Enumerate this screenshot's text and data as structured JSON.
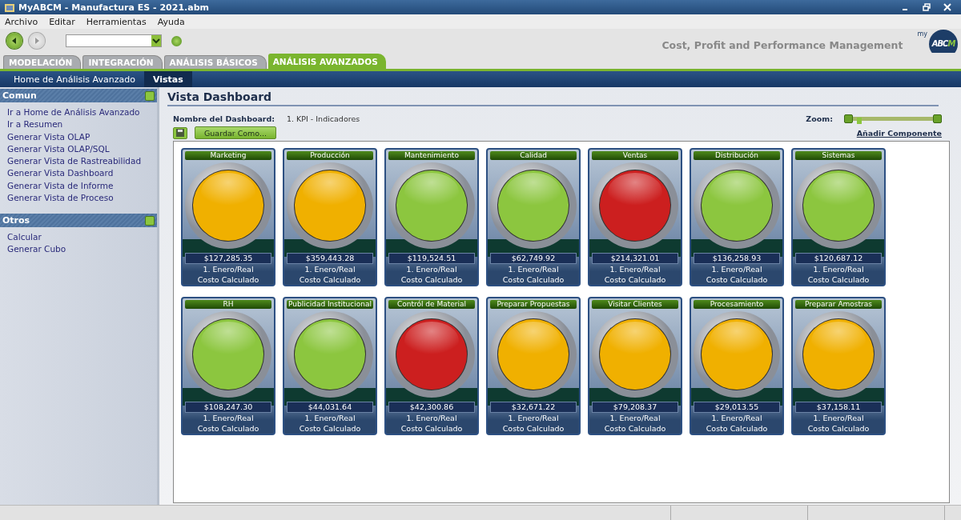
{
  "window": {
    "title": "MyABCM - Manufactura ES - 2021.abm"
  },
  "menu": [
    "Archivo",
    "Editar",
    "Herramientas",
    "Ayuda"
  ],
  "toolbar": {
    "tagline": "Cost, Profit and Performance Management",
    "logo": {
      "prefix": "my",
      "letters": "ABC",
      "accent": "M"
    }
  },
  "tabs": [
    {
      "label": "MODELACIÓN",
      "selected": false
    },
    {
      "label": "INTEGRACIÓN",
      "selected": false
    },
    {
      "label": "ANÁLISIS BÁSICOS",
      "selected": false
    },
    {
      "label": "ANÁLISIS AVANZADOS",
      "selected": true
    }
  ],
  "subnav": [
    {
      "label": "Home de Análisis Avanzado",
      "selected": false
    },
    {
      "label": "Vistas",
      "selected": true
    }
  ],
  "sidebar": {
    "sections": [
      {
        "title": "Comun",
        "items": [
          "Ir a Home de Análisis Avanzado",
          "Ir a Resumen",
          "Generar Vista OLAP",
          "Generar Vista OLAP/SQL",
          "Generar Vista de Rastreabilidad",
          "Generar Vista Dashboard",
          "Generar Vista de Informe",
          "Generar Vista de Proceso"
        ]
      },
      {
        "title": "Otros",
        "items": [
          "Calcular",
          "Generar Cubo"
        ]
      }
    ]
  },
  "content": {
    "title": "Vista Dashboard",
    "name_label": "Nombre del Dashboard:",
    "name_value": "1. KPI - Indicadores",
    "zoom": {
      "label": "Zoom:",
      "level": 0.05
    },
    "save_as": "Guardar Como...",
    "add_component": "Añadir Componente",
    "indicators": [
      {
        "title": "Marketing",
        "color": "#f0b000",
        "value": "$127,285.35",
        "period": "1. Enero/Real",
        "measure": "Costo Calculado"
      },
      {
        "title": "Producción",
        "color": "#f0b000",
        "value": "$359,443.28",
        "period": "1. Enero/Real",
        "measure": "Costo Calculado"
      },
      {
        "title": "Mantenimiento",
        "color": "#8cc63f",
        "value": "$119,524.51",
        "period": "1. Enero/Real",
        "measure": "Costo Calculado"
      },
      {
        "title": "Calidad",
        "color": "#8cc63f",
        "value": "$62,749.92",
        "period": "1. Enero/Real",
        "measure": "Costo Calculado"
      },
      {
        "title": "Ventas",
        "color": "#cc1f1f",
        "value": "$214,321.01",
        "period": "1. Enero/Real",
        "measure": "Costo Calculado"
      },
      {
        "title": "Distribución",
        "color": "#8cc63f",
        "value": "$136,258.93",
        "period": "1. Enero/Real",
        "measure": "Costo Calculado"
      },
      {
        "title": "Sistemas",
        "color": "#8cc63f",
        "value": "$120,687.12",
        "period": "1. Enero/Real",
        "measure": "Costo Calculado"
      },
      {
        "title": "RH",
        "color": "#8cc63f",
        "value": "$108,247.30",
        "period": "1. Enero/Real",
        "measure": "Costo Calculado"
      },
      {
        "title": "Publicidad Institucional",
        "color": "#8cc63f",
        "value": "$44,031.64",
        "period": "1. Enero/Real",
        "measure": "Costo Calculado"
      },
      {
        "title": "Contról de Material",
        "color": "#cc1f1f",
        "value": "$42,300.86",
        "period": "1. Enero/Real",
        "measure": "Costo Calculado"
      },
      {
        "title": "Preparar Propuestas",
        "color": "#f0b000",
        "value": "$32,671.22",
        "period": "1. Enero/Real",
        "measure": "Costo Calculado"
      },
      {
        "title": "Visitar Clientes",
        "color": "#f0b000",
        "value": "$79,208.37",
        "period": "1. Enero/Real",
        "measure": "Costo Calculado"
      },
      {
        "title": "Procesamiento",
        "color": "#f0b000",
        "value": "$29,013.55",
        "period": "1. Enero/Real",
        "measure": "Costo Calculado"
      },
      {
        "title": "Preparar Amostras",
        "color": "#f0b000",
        "value": "$37,158.11",
        "period": "1. Enero/Real",
        "measure": "Costo Calculado"
      }
    ]
  }
}
